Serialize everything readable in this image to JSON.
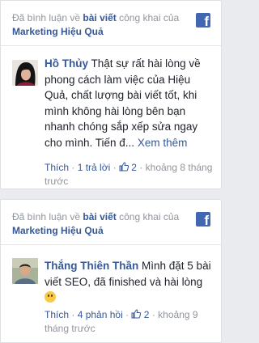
{
  "comments": [
    {
      "action_text": "Đã bình luận về",
      "post_link": "bài viết",
      "public_of": "công khai của",
      "page_name": "Marketing Hiệu Quả",
      "author": "Hồ Thủy",
      "text": "Thật sự rất hài lòng về phong cách làm việc của Hiệu Quả, chất lượng bài viết tốt, khi mình không hài lòng bên bạn nhanh chóng sắp xếp sửa ngay cho mình. Tiến đ...",
      "see_more": "Xem thêm",
      "like_label": "Thích",
      "reply_label": "1 trả lời",
      "like_count": "2",
      "time": "khoảng 8 tháng trước",
      "dot": "·"
    },
    {
      "action_text": "Đã bình luận về",
      "post_link": "bài viết",
      "public_of": "công khai của",
      "page_name": "Marketing Hiệu Quả",
      "author": "Thắng Thiên Thần",
      "text": "Mình đặt 5 bài viết SEO, đã finished và hài lòng",
      "like_label": "Thích",
      "reply_label": "4 phản hồi",
      "like_count": "2",
      "time": "khoảng 9 tháng trước",
      "dot": "·"
    }
  ],
  "icons": {
    "brand": "facebook-icon",
    "like": "thumbs-up-icon",
    "emoji": "smile-emoji-icon"
  },
  "colors": {
    "link": "#365899",
    "meta": "#90949c",
    "brand": "#4267b2",
    "text": "#1d2129"
  }
}
